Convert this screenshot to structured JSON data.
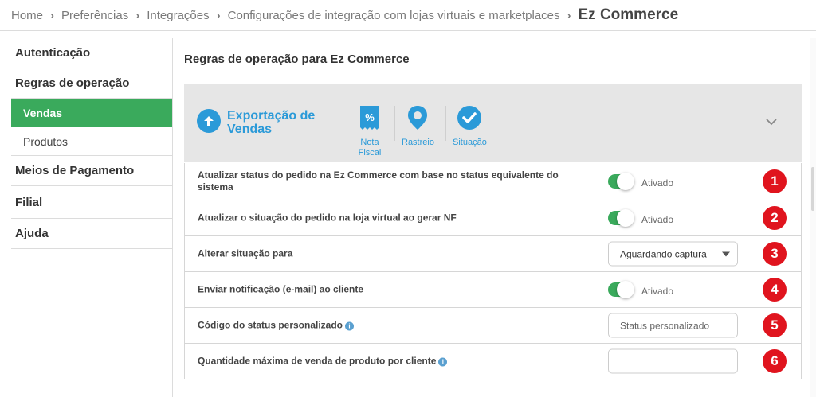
{
  "breadcrumb": {
    "items": [
      "Home",
      "Preferências",
      "Integrações",
      "Configurações de integração com lojas virtuais e marketplaces"
    ],
    "current": "Ez Commerce"
  },
  "sidebar": {
    "items": [
      {
        "label": "Autenticação"
      },
      {
        "label": "Regras de operação"
      },
      {
        "label": "Vendas"
      },
      {
        "label": "Produtos"
      },
      {
        "label": "Meios de Pagamento"
      },
      {
        "label": "Filial"
      },
      {
        "label": "Ajuda"
      }
    ]
  },
  "main": {
    "title": "Regras de operação para Ez Commerce",
    "section_title": "Exportação de Vendas",
    "tabs": [
      {
        "label": "Nota Fiscal",
        "icon": "receipt-percent-icon"
      },
      {
        "label": "Rastreio",
        "icon": "map-pin-icon"
      },
      {
        "label": "Situação",
        "icon": "check-circle-icon"
      }
    ],
    "rows": [
      {
        "label": "Atualizar status do pedido na Ez Commerce com base no status equivalente do sistema",
        "control": "toggle",
        "value": "Ativado",
        "badge": "1"
      },
      {
        "label": "Atualizar o situação do pedido na loja virtual ao gerar NF",
        "control": "toggle",
        "value": "Ativado",
        "badge": "2"
      },
      {
        "label": "Alterar situação para",
        "control": "select",
        "value": "Aguardando captura",
        "badge": "3"
      },
      {
        "label": "Enviar notificação (e-mail) ao cliente",
        "control": "toggle",
        "value": "Ativado",
        "badge": "4"
      },
      {
        "label": "Código do status personalizado",
        "control": "input",
        "placeholder": "Status personalizado",
        "value": "",
        "badge": "5"
      },
      {
        "label": "Quantidade máxima de venda de produto por cliente",
        "control": "input",
        "placeholder": "",
        "value": "",
        "badge": "6"
      }
    ]
  },
  "colors": {
    "accent_blue": "#2b9ad8",
    "active_green": "#3aaa5c",
    "badge_red": "#e0141e"
  }
}
